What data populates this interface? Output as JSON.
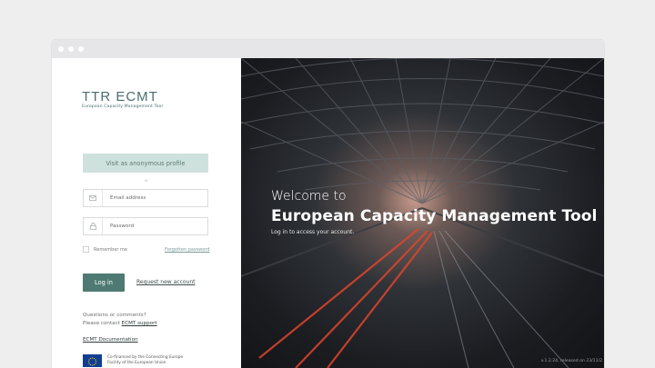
{
  "logo": {
    "wordmark": "TTR ECMT",
    "subtitle": "European Capacity Management Tool"
  },
  "login": {
    "anonymous_label": "Visit as anonymous profile",
    "or_label": "or",
    "email_placeholder": "Email address",
    "password_placeholder": "Password",
    "remember_label": "Remember me",
    "forgot_label": "Forgotten password",
    "login_label": "Log in",
    "request_label": "Request new account"
  },
  "footer": {
    "questions_line1": "Questions or comments?",
    "contact_prefix": "Please contact ",
    "support_link": "ECMT support",
    "documentation_link": "ECMT Documentation",
    "eu_text_line1": "Co-financed by the Connecting Europe",
    "eu_text_line2": "Facility of the European Union"
  },
  "hero": {
    "welcome": "Welcome to",
    "title": "European Capacity Management Tool",
    "subtitle": "Log in to access your account.",
    "version": "v.1.2.24, released on 23/11/2"
  },
  "icons": {
    "email": "mail-icon",
    "password": "lock-icon"
  },
  "colors": {
    "primary": "#4e7a73",
    "anonymous_bg": "#cfe1dd",
    "logo": "#4a6d6d",
    "eu_flag": "#123e92"
  }
}
